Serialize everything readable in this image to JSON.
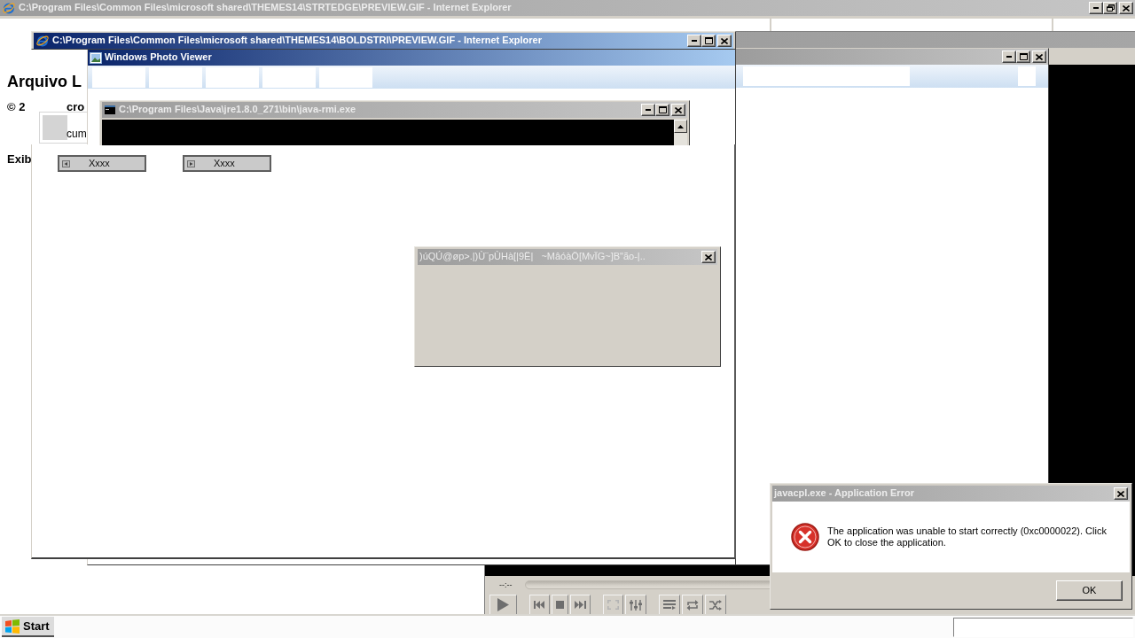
{
  "background_browser": {
    "active": false,
    "title": "C:\\Program Files\\Common Files\\microsoft shared\\THEMES14\\STRTEDGE\\PREVIEW.GIF - Internet Explorer",
    "page": {
      "heading": "Arquivo L",
      "copyright_line": "© 2",
      "item_title": "cro",
      "item_text": "cum",
      "section_label": "Exib"
    }
  },
  "media_player": {
    "active": false,
    "time": "--:--"
  },
  "side_window": {
    "active": false
  },
  "photo_viewer": {
    "active": true,
    "title": "Windows Photo Viewer"
  },
  "browser_window": {
    "active": true,
    "title": "C:\\Program Files\\Common Files\\microsoft shared\\THEMES14\\BOLDSTRI\\PREVIEW.GIF - Internet Explorer",
    "buttons": [
      {
        "kind": "back",
        "label": "Xxxx"
      },
      {
        "kind": "forward",
        "label": "Xxxx"
      }
    ]
  },
  "console_window": {
    "active": false,
    "title": "C:\\Program Files\\Java\\jre1.8.0_271\\bin\\java-rmi.exe"
  },
  "unnamed_dialog": {
    "active": false,
    "title": ")úQÚ@øp>.|)Ù¨pÙHà[|9Ë|   ~MâóàÖ[MvÏG~]B\"ão-|.."
  },
  "error_dialog": {
    "active": false,
    "title": "javacpl.exe - Application Error",
    "message": "The application was unable to start correctly (0xc0000022). Click OK to close the application.",
    "button": "OK"
  },
  "taskbar": {
    "start_label": "Start"
  }
}
